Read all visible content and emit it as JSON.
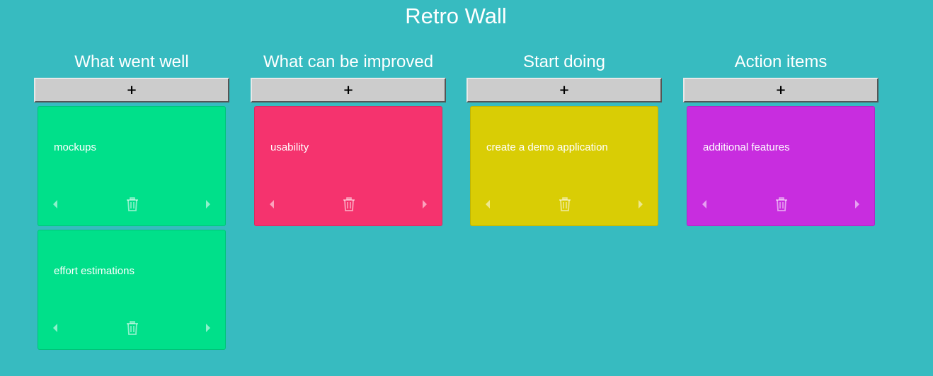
{
  "app": {
    "title": "Retro Wall"
  },
  "add_label": "+",
  "icons": {
    "move_left": "caret-left-icon",
    "move_right": "caret-right-icon",
    "delete": "trash-icon"
  },
  "colors": {
    "background": "#37bbc0",
    "control": "rgba(255,255,255,0.55)"
  },
  "columns": [
    {
      "title": "What went well",
      "color": "#00e08a",
      "cards": [
        {
          "text": "mockups"
        },
        {
          "text": "effort estimations"
        }
      ]
    },
    {
      "title": "What can be improved",
      "color": "#f5336e",
      "cards": [
        {
          "text": "usability"
        }
      ]
    },
    {
      "title": "Start doing",
      "color": "#d9cd05",
      "cards": [
        {
          "text": "create a demo application"
        }
      ]
    },
    {
      "title": "Action items",
      "color": "#c82ddf",
      "cards": [
        {
          "text": "additional features"
        }
      ]
    }
  ]
}
